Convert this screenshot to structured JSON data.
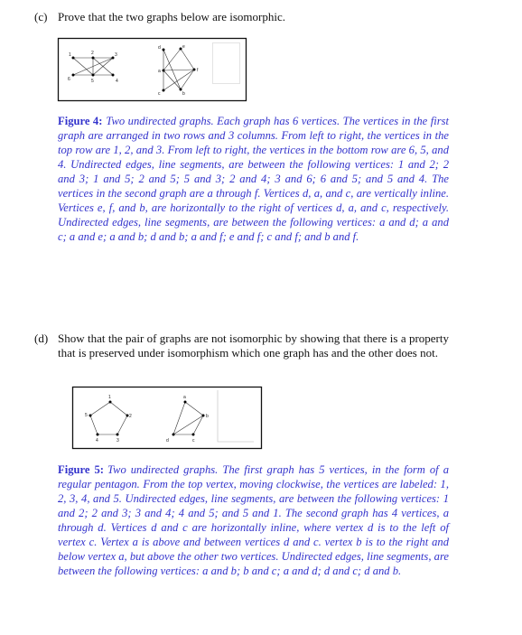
{
  "part_c": {
    "label": "(c)",
    "text": "Prove that the two graphs below are isomorphic."
  },
  "figure4": {
    "label": "Figure 4:",
    "caption": "Two undirected graphs. Each graph has 6 vertices. The vertices in the first graph are arranged in two rows and 3 columns. From left to right, the vertices in the top row are 1, 2, and 3. From left to right, the vertices in the bottom row are 6, 5, and 4. Undirected edges, line segments, are between the following vertices: 1 and 2; 2 and 3; 1 and 5; 2 and 5; 5 and 3; 2 and 4; 3 and 6; 6 and 5; and 5 and 4. The vertices in the second graph are a through f. Vertices d, a, and c, are vertically inline. Vertices e, f, and b, are horizontally to the right of vertices d, a, and c, respectively. Undirected edges, line segments, are between the following vertices: a and d; a and c; a and e; a and b; d and b; a and f; e and f; c and f; and b and f.",
    "graph1_labels": [
      "1",
      "2",
      "3",
      "6",
      "5",
      "4"
    ],
    "graph2_labels": [
      "d",
      "e",
      "a",
      "f",
      "c",
      "b"
    ]
  },
  "part_d": {
    "label": "(d)",
    "text": "Show that the pair of graphs are not isomorphic by showing that there is a property that is preserved under isomorphism which one graph has and the other does not."
  },
  "figure5": {
    "label": "Figure 5:",
    "caption": "Two undirected graphs. The first graph has 5 vertices, in the form of a regular pentagon. From the top vertex, moving clockwise, the vertices are labeled: 1, 2, 3, 4, and 5. Undirected edges, line segments, are between the following vertices: 1 and 2; 2 and 3; 3 and 4; 4 and 5; and 5 and 1. The second graph has 4 vertices, a through d. Vertices d and c are horizontally inline, where vertex d is to the left of vertex c. Vertex a is above and between vertices d and c. vertex b is to the right and below vertex a, but above the other two vertices. Undirected edges, line segments, are between the following vertices: a and b; b and c; a and d; d and c; d and b.",
    "graph1_labels": [
      "1",
      "2",
      "3",
      "4",
      "5"
    ],
    "graph2_labels": [
      "a",
      "b",
      "c",
      "d"
    ]
  },
  "colors": {
    "caption": "#3333cc"
  }
}
